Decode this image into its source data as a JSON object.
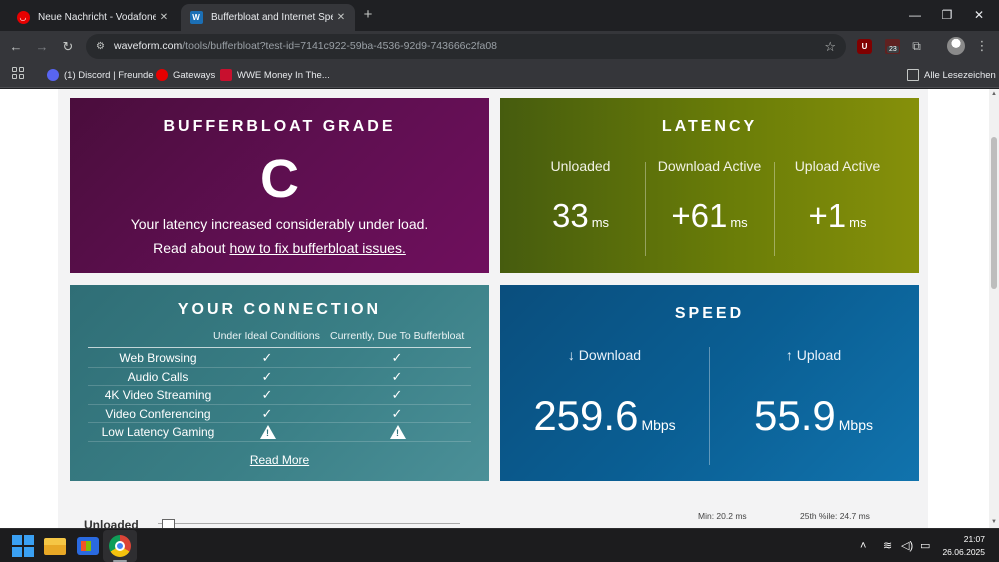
{
  "browser": {
    "tabs": [
      {
        "title": "Neue Nachricht - Vodafone Co",
        "favicon": "vodafone-icon"
      },
      {
        "title": "Bufferbloat and Internet Speed",
        "favicon": "waveform-icon",
        "active": true
      }
    ],
    "url_domain": "waveform.com",
    "url_path": "/tools/bufferbloat?test-id=7141c922-59ba-4536-92d9-743666c2fa08",
    "extension_badge": "23",
    "bookmarks": [
      {
        "label": "(1) Discord | Freunde",
        "icon": "discord-icon"
      },
      {
        "label": "Gateways",
        "icon": "vodafone-icon"
      },
      {
        "label": "WWE Money In The...",
        "icon": "wwe-icon"
      }
    ],
    "bookmarks_folder": "Alle Lesezeichen"
  },
  "grade": {
    "title": "BUFFERBLOAT GRADE",
    "letter": "C",
    "description": "Your latency increased considerably under load.",
    "link_prefix": "Read about ",
    "link_text": "how to fix bufferbloat issues."
  },
  "latency": {
    "title": "LATENCY",
    "columns": [
      {
        "label": "Unloaded",
        "value": "33",
        "unit": "ms"
      },
      {
        "label": "Download Active",
        "value": "+61",
        "unit": "ms"
      },
      {
        "label": "Upload Active",
        "value": "+1",
        "unit": "ms"
      }
    ]
  },
  "connection": {
    "title": "YOUR CONNECTION",
    "header_ideal": "Under Ideal Conditions",
    "header_current": "Currently, Due To Bufferbloat",
    "rows": [
      {
        "name": "Web Browsing",
        "ideal": "check",
        "current": "check"
      },
      {
        "name": "Audio Calls",
        "ideal": "check",
        "current": "check"
      },
      {
        "name": "4K Video Streaming",
        "ideal": "check",
        "current": "check"
      },
      {
        "name": "Video Conferencing",
        "ideal": "check",
        "current": "check"
      },
      {
        "name": "Low Latency Gaming",
        "ideal": "warning",
        "current": "warning"
      }
    ],
    "read_more": "Read More"
  },
  "speed": {
    "title": "SPEED",
    "download": {
      "label": "↓ Download",
      "value": "259.6",
      "unit": "Mbps"
    },
    "upload": {
      "label": "↑ Upload",
      "value": "55.9",
      "unit": "Mbps"
    }
  },
  "below": {
    "label": "Unloaded",
    "stats": [
      "Min: 20.2 ms",
      "25th %ile: 24.7 ms"
    ]
  },
  "taskbar": {
    "time": "21:07",
    "date": "26.06.2025"
  },
  "colors": {
    "grade_panel": "#5e0f50",
    "latency_panel": "#6a7d08",
    "connection_panel": "#3a7f86",
    "speed_panel": "#0a5e93"
  }
}
